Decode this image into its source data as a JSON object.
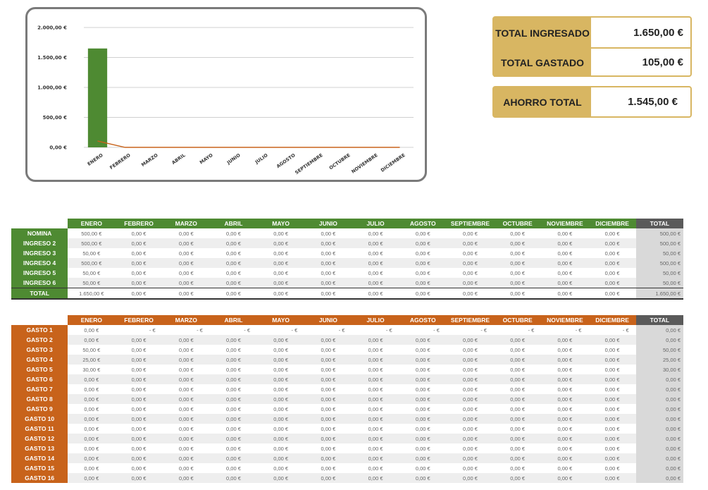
{
  "chart_data": {
    "type": "bar",
    "categories": [
      "ENERO",
      "FEBRERO",
      "MARZO",
      "ABRIL",
      "MAYO",
      "JUNIO",
      "JULIO",
      "AGOSTO",
      "SEPTIEMBRE",
      "OCTUBRE",
      "NOVIEMBRE",
      "DICIEMBRE"
    ],
    "series": [
      {
        "values": [
          1650,
          0,
          0,
          0,
          0,
          0,
          0,
          0,
          0,
          0,
          0,
          0
        ],
        "color": "#4e8a32",
        "kind": "bar"
      },
      {
        "values": [
          105,
          0,
          0,
          0,
          0,
          0,
          0,
          0,
          0,
          0,
          0,
          0
        ],
        "color": "#c8631b",
        "kind": "line"
      }
    ],
    "ylim": [
      0,
      2000
    ],
    "yticks": [
      "0,00 €",
      "500,00 €",
      "1.000,00 €",
      "1.500,00 €",
      "2.000,00 €"
    ],
    "grid": true
  },
  "summary": {
    "ingresado_label": "TOTAL INGRESADO",
    "ingresado_value": "1.650,00 €",
    "gastado_label": "TOTAL GASTADO",
    "gastado_value": "105,00 €",
    "ahorro_label": "AHORRO TOTAL",
    "ahorro_value": "1.545,00 €",
    "accent_color": "#d8b662"
  },
  "months": [
    "ENERO",
    "FEBRERO",
    "MARZO",
    "ABRIL",
    "MAYO",
    "JUNIO",
    "JULIO",
    "AGOSTO",
    "SEPTIEMBRE",
    "OCTUBRE",
    "NOVIEMBRE",
    "DICIEMBRE"
  ],
  "total_label": "TOTAL",
  "ingresos": {
    "color": "#4e8a32",
    "rows": [
      {
        "label": "NOMINA",
        "values": [
          "500,00 €",
          "0,00 €",
          "0,00 €",
          "0,00 €",
          "0,00 €",
          "0,00 €",
          "0,00 €",
          "0,00 €",
          "0,00 €",
          "0,00 €",
          "0,00 €",
          "0,00 €"
        ],
        "total": "500,00 €"
      },
      {
        "label": "INGRESO 2",
        "values": [
          "500,00 €",
          "0,00 €",
          "0,00 €",
          "0,00 €",
          "0,00 €",
          "0,00 €",
          "0,00 €",
          "0,00 €",
          "0,00 €",
          "0,00 €",
          "0,00 €",
          "0,00 €"
        ],
        "total": "500,00 €"
      },
      {
        "label": "INGRESO 3",
        "values": [
          "50,00 €",
          "0,00 €",
          "0,00 €",
          "0,00 €",
          "0,00 €",
          "0,00 €",
          "0,00 €",
          "0,00 €",
          "0,00 €",
          "0,00 €",
          "0,00 €",
          "0,00 €"
        ],
        "total": "50,00 €"
      },
      {
        "label": "INGRESO 4",
        "values": [
          "500,00 €",
          "0,00 €",
          "0,00 €",
          "0,00 €",
          "0,00 €",
          "0,00 €",
          "0,00 €",
          "0,00 €",
          "0,00 €",
          "0,00 €",
          "0,00 €",
          "0,00 €"
        ],
        "total": "500,00 €"
      },
      {
        "label": "INGRESO 5",
        "values": [
          "50,00 €",
          "0,00 €",
          "0,00 €",
          "0,00 €",
          "0,00 €",
          "0,00 €",
          "0,00 €",
          "0,00 €",
          "0,00 €",
          "0,00 €",
          "0,00 €",
          "0,00 €"
        ],
        "total": "50,00 €"
      },
      {
        "label": "INGRESO 6",
        "values": [
          "50,00 €",
          "0,00 €",
          "0,00 €",
          "0,00 €",
          "0,00 €",
          "0,00 €",
          "0,00 €",
          "0,00 €",
          "0,00 €",
          "0,00 €",
          "0,00 €",
          "0,00 €"
        ],
        "total": "50,00 €"
      }
    ],
    "total_row": {
      "label": "TOTAL",
      "values": [
        "1.650,00 €",
        "0,00 €",
        "0,00 €",
        "0,00 €",
        "0,00 €",
        "0,00 €",
        "0,00 €",
        "0,00 €",
        "0,00 €",
        "0,00 €",
        "0,00 €",
        "0,00 €"
      ],
      "total": "1.650,00 €"
    }
  },
  "gastos": {
    "color": "#c8631b",
    "rows": [
      {
        "label": "GASTO 1",
        "values": [
          "0,00 €",
          "-   €",
          "-   €",
          "-   €",
          "-   €",
          "-   €",
          "-   €",
          "-   €",
          "-   €",
          "-   €",
          "-   €",
          "-   €"
        ],
        "total": "0,00 €"
      },
      {
        "label": "GASTO 2",
        "values": [
          "0,00 €",
          "0,00 €",
          "0,00 €",
          "0,00 €",
          "0,00 €",
          "0,00 €",
          "0,00 €",
          "0,00 €",
          "0,00 €",
          "0,00 €",
          "0,00 €",
          "0,00 €"
        ],
        "total": "0,00 €"
      },
      {
        "label": "GASTO 3",
        "values": [
          "50,00 €",
          "0,00 €",
          "0,00 €",
          "0,00 €",
          "0,00 €",
          "0,00 €",
          "0,00 €",
          "0,00 €",
          "0,00 €",
          "0,00 €",
          "0,00 €",
          "0,00 €"
        ],
        "total": "50,00 €"
      },
      {
        "label": "GASTO 4",
        "values": [
          "25,00 €",
          "0,00 €",
          "0,00 €",
          "0,00 €",
          "0,00 €",
          "0,00 €",
          "0,00 €",
          "0,00 €",
          "0,00 €",
          "0,00 €",
          "0,00 €",
          "0,00 €"
        ],
        "total": "25,00 €"
      },
      {
        "label": "GASTO 5",
        "values": [
          "30,00 €",
          "0,00 €",
          "0,00 €",
          "0,00 €",
          "0,00 €",
          "0,00 €",
          "0,00 €",
          "0,00 €",
          "0,00 €",
          "0,00 €",
          "0,00 €",
          "0,00 €"
        ],
        "total": "30,00 €"
      },
      {
        "label": "GASTO 6",
        "values": [
          "0,00 €",
          "0,00 €",
          "0,00 €",
          "0,00 €",
          "0,00 €",
          "0,00 €",
          "0,00 €",
          "0,00 €",
          "0,00 €",
          "0,00 €",
          "0,00 €",
          "0,00 €"
        ],
        "total": "0,00 €"
      },
      {
        "label": "GASTO 7",
        "values": [
          "0,00 €",
          "0,00 €",
          "0,00 €",
          "0,00 €",
          "0,00 €",
          "0,00 €",
          "0,00 €",
          "0,00 €",
          "0,00 €",
          "0,00 €",
          "0,00 €",
          "0,00 €"
        ],
        "total": "0,00 €"
      },
      {
        "label": "GASTO 8",
        "values": [
          "0,00 €",
          "0,00 €",
          "0,00 €",
          "0,00 €",
          "0,00 €",
          "0,00 €",
          "0,00 €",
          "0,00 €",
          "0,00 €",
          "0,00 €",
          "0,00 €",
          "0,00 €"
        ],
        "total": "0,00 €"
      },
      {
        "label": "GASTO 9",
        "values": [
          "0,00 €",
          "0,00 €",
          "0,00 €",
          "0,00 €",
          "0,00 €",
          "0,00 €",
          "0,00 €",
          "0,00 €",
          "0,00 €",
          "0,00 €",
          "0,00 €",
          "0,00 €"
        ],
        "total": "0,00 €"
      },
      {
        "label": "GASTO 10",
        "values": [
          "0,00 €",
          "0,00 €",
          "0,00 €",
          "0,00 €",
          "0,00 €",
          "0,00 €",
          "0,00 €",
          "0,00 €",
          "0,00 €",
          "0,00 €",
          "0,00 €",
          "0,00 €"
        ],
        "total": "0,00 €"
      },
      {
        "label": "GASTO 11",
        "values": [
          "0,00 €",
          "0,00 €",
          "0,00 €",
          "0,00 €",
          "0,00 €",
          "0,00 €",
          "0,00 €",
          "0,00 €",
          "0,00 €",
          "0,00 €",
          "0,00 €",
          "0,00 €"
        ],
        "total": "0,00 €"
      },
      {
        "label": "GASTO 12",
        "values": [
          "0,00 €",
          "0,00 €",
          "0,00 €",
          "0,00 €",
          "0,00 €",
          "0,00 €",
          "0,00 €",
          "0,00 €",
          "0,00 €",
          "0,00 €",
          "0,00 €",
          "0,00 €"
        ],
        "total": "0,00 €"
      },
      {
        "label": "GASTO 13",
        "values": [
          "0,00 €",
          "0,00 €",
          "0,00 €",
          "0,00 €",
          "0,00 €",
          "0,00 €",
          "0,00 €",
          "0,00 €",
          "0,00 €",
          "0,00 €",
          "0,00 €",
          "0,00 €"
        ],
        "total": "0,00 €"
      },
      {
        "label": "GASTO 14",
        "values": [
          "0,00 €",
          "0,00 €",
          "0,00 €",
          "0,00 €",
          "0,00 €",
          "0,00 €",
          "0,00 €",
          "0,00 €",
          "0,00 €",
          "0,00 €",
          "0,00 €",
          "0,00 €"
        ],
        "total": "0,00 €"
      },
      {
        "label": "GASTO 15",
        "values": [
          "0,00 €",
          "0,00 €",
          "0,00 €",
          "0,00 €",
          "0,00 €",
          "0,00 €",
          "0,00 €",
          "0,00 €",
          "0,00 €",
          "0,00 €",
          "0,00 €",
          "0,00 €"
        ],
        "total": "0,00 €"
      },
      {
        "label": "GASTO 16",
        "values": [
          "0,00 €",
          "0,00 €",
          "0,00 €",
          "0,00 €",
          "0,00 €",
          "0,00 €",
          "0,00 €",
          "0,00 €",
          "0,00 €",
          "0,00 €",
          "0,00 €",
          "0,00 €"
        ],
        "total": "0,00 €"
      }
    ]
  }
}
